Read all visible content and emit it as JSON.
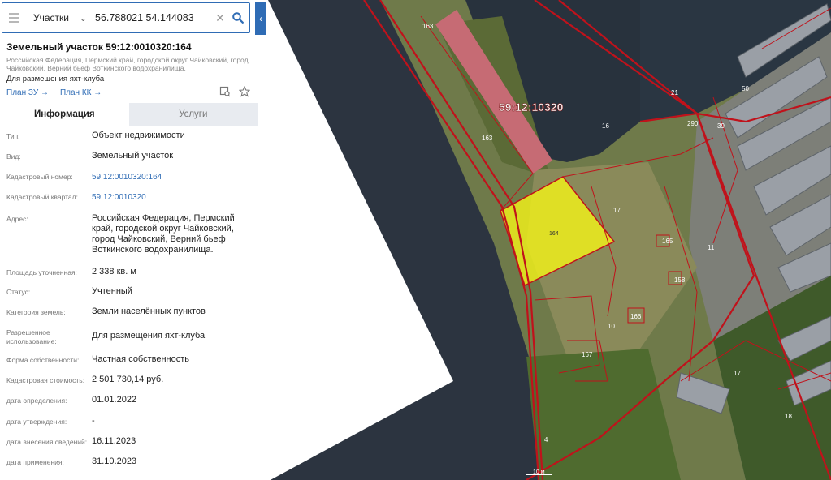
{
  "search": {
    "layer": "Участки",
    "value": "56.788021 54.144083"
  },
  "parcel": {
    "title": "Земельный участок 59:12:0010320:164",
    "address_short": "Российская Федерация, Пермский край, городской округ Чайковский, город Чайковский, Верний бьеф Воткинского водохранилища.",
    "purpose": "Для размещения яхт-клуба",
    "link_zu": "План ЗУ",
    "link_kk": "План КК"
  },
  "tabs": {
    "info": "Информация",
    "services": "Услуги"
  },
  "info": {
    "type_label": "Тип:",
    "type_value": "Объект недвижимости",
    "kind_label": "Вид:",
    "kind_value": "Земельный участок",
    "cadnum_label": "Кадастровый номер:",
    "cadnum_value": "59:12:0010320:164",
    "quarter_label": "Кадастровый квартал:",
    "quarter_value": "59:12:0010320",
    "address_label": "Адрес:",
    "address_value": "Российская Федерация, Пермский край, городской округ Чайковский, город Чайковский, Верний бьеф Воткинского водохранилища.",
    "area_label": "Площадь уточненная:",
    "area_value": "2 338 кв. м",
    "status_label": "Статус:",
    "status_value": "Учтенный",
    "category_label": "Категория земель:",
    "category_value": "Земли населённых пунктов",
    "use_label": "Разрешенное использование:",
    "use_value": "Для размещения яхт-клуба",
    "ownership_label": "Форма собственности:",
    "ownership_value": "Частная собственность",
    "cost_label": "Кадастровая стоимость:",
    "cost_value": "2 501 730,14 руб.",
    "def_date_label": "дата определения:",
    "def_date_value": "01.01.2022",
    "approve_date_label": "дата утверждения:",
    "approve_date_value": "-",
    "entry_date_label": "дата внесения сведений:",
    "entry_date_value": "16.11.2023",
    "apply_date_label": "дата применения:",
    "apply_date_value": "31.10.2023"
  },
  "map": {
    "quarter_label": "59:12:10320",
    "parcel_label": "164",
    "scale_label": "10 м",
    "labels": [
      "163",
      "163",
      "16",
      "17",
      "11",
      "165",
      "158",
      "166",
      "10",
      "167",
      "17",
      "18",
      "21",
      "39",
      "50",
      "290",
      "4"
    ],
    "colors": {
      "boundary": "#c0121b",
      "selected": "#f2f21a",
      "water": "#2c3440"
    }
  }
}
